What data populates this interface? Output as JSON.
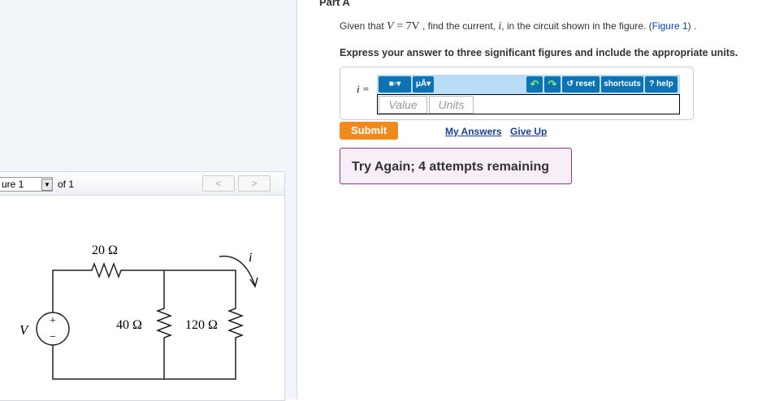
{
  "figure_nav": {
    "selected": "ure 1",
    "of_label": "of 1",
    "prev": "<",
    "next": ">"
  },
  "circuit": {
    "r1": "20 Ω",
    "r2": "40 Ω",
    "r3": "120 Ω",
    "source": "V",
    "current": "i",
    "plus": "+",
    "minus": "−"
  },
  "part": {
    "title": "Part A",
    "given_pre": "Given that ",
    "given_var": "V",
    "given_eq": " = 7V",
    "given_mid": " , find the current, ",
    "given_i": "i",
    "given_post": ", in the circuit shown in the figure. (",
    "figure_link": "Figure 1",
    "given_end": ") .",
    "instruction": "Express your answer to three significant figures and include the appropriate units."
  },
  "answer": {
    "label": "i =",
    "templates": "■▫▾",
    "units_btn": "μÅ▾",
    "undo": "↶",
    "redo": "↷",
    "reset": "↺ reset",
    "shortcuts": "shortcuts",
    "help": "? help",
    "value_placeholder": "Value",
    "units_placeholder": "Units"
  },
  "actions": {
    "submit": "Submit",
    "my_answers": "My Answers",
    "give_up": "Give Up"
  },
  "feedback": "Try Again; 4 attempts remaining"
}
